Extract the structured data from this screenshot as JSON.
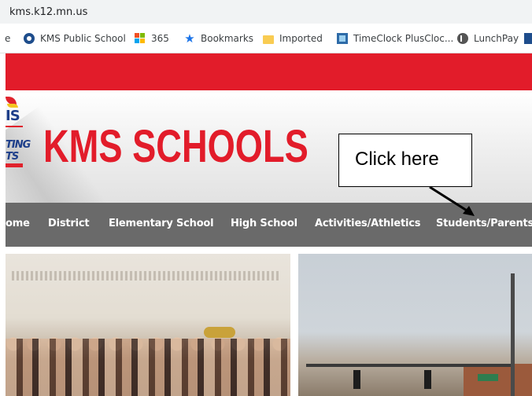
{
  "browser": {
    "url": "kms.k12.mn.us",
    "bookmarks": [
      {
        "label": "e",
        "icon": "bookmark-fragment"
      },
      {
        "label": "KMS Public School",
        "icon": "kms-favicon-icon"
      },
      {
        "label": "365",
        "icon": "microsoft-icon"
      },
      {
        "label": "Bookmarks",
        "icon": "star-icon"
      },
      {
        "label": "Imported",
        "icon": "folder-icon"
      },
      {
        "label": "TimeClock PlusCloc...",
        "icon": "timeclock-icon"
      },
      {
        "label": "LunchPay",
        "icon": "lunchpay-icon"
      }
    ]
  },
  "site": {
    "title": "KMS SCHOOLS",
    "logo_text": [
      "IS",
      "TING",
      "TS"
    ],
    "colors": {
      "red": "#e21c2a",
      "nav": "#6a6a6a",
      "logo_blue": "#1e3f8a"
    },
    "nav": [
      "ome",
      "District",
      "Elementary School",
      "High School",
      "Activities/Athletics",
      "Students/Parents"
    ]
  },
  "annotation": {
    "callout_text": "Click here"
  }
}
